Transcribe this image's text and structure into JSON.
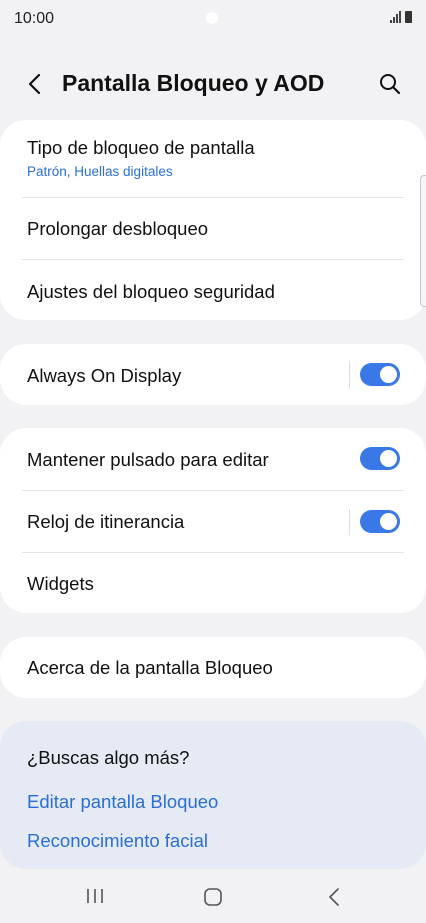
{
  "status_bar": {
    "time": "10:00",
    "icons": [
      "signal-icon",
      "battery-icon"
    ]
  },
  "header": {
    "title": "Pantalla Bloqueo y AOD",
    "icons": [
      "back-icon",
      "search-icon"
    ]
  },
  "group1": {
    "lock_type": {
      "label": "Tipo de bloqueo de pantalla",
      "value": "Patrón, Huellas digitales"
    },
    "extend_unlock": {
      "label": "Prolongar desbloqueo"
    },
    "security_settings": {
      "label": "Ajustes del bloqueo seguridad"
    }
  },
  "group2": {
    "always_on_display": {
      "label": "Always On Display",
      "toggle_on": true
    }
  },
  "group3": {
    "hold_to_edit": {
      "label": "Mantener pulsado para editar",
      "toggle_on": true
    },
    "roaming_clock": {
      "label": "Reloj de itinerancia",
      "toggle_on": true
    },
    "widgets": {
      "label": "Widgets"
    }
  },
  "group4": {
    "about": {
      "label": "Acerca de la pantalla Bloqueo"
    }
  },
  "looking_for_more": {
    "title": "¿Buscas algo más?",
    "links": [
      "Editar pantalla Bloqueo",
      "Reconocimiento facial"
    ]
  },
  "colors": {
    "accent": "#3b78e7",
    "link": "#2a6fd4",
    "background": "#f2f2f4",
    "card": "#ffffff",
    "suggest_bg": "#e6eaf4"
  },
  "nav_bar": {
    "icons": [
      "recents-icon",
      "home-icon",
      "back-nav-icon"
    ]
  }
}
